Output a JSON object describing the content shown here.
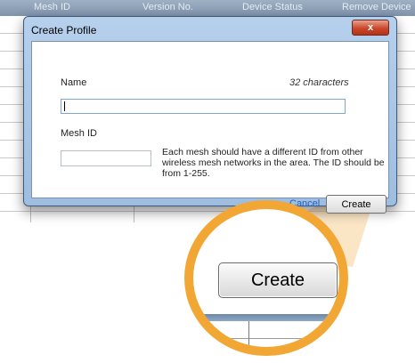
{
  "background_table": {
    "columns": [
      "Mesh ID",
      "Version No.",
      "Device Status",
      "Remove Device"
    ]
  },
  "dialog": {
    "title": "Create Profile",
    "close_label": "x",
    "name_label": "Name",
    "char_limit": "32 characters",
    "name_value": "",
    "mesh_id_label": "Mesh ID",
    "mesh_id_value": "",
    "help_text": "Each mesh should have a different ID from other wireless mesh networks in the area. The ID should be from 1-255.",
    "cancel_label": "Cancel",
    "create_label": "Create"
  },
  "zoom": {
    "create_label": "Create"
  },
  "colors": {
    "magnifier_ring": "#f2a634",
    "close_button": "#c9482b",
    "link": "#1f5fbf"
  }
}
